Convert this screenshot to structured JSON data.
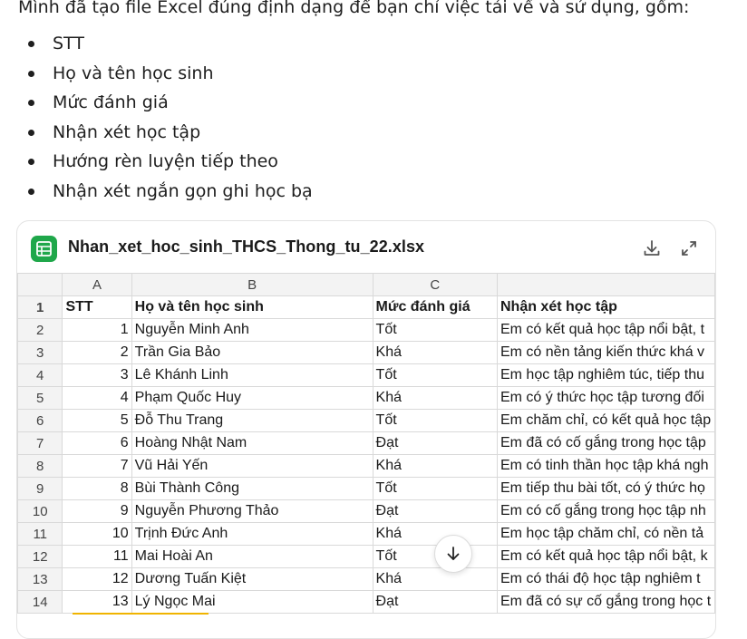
{
  "message": {
    "intro": "Mình đã tạo file Excel đúng định dạng để bạn chỉ việc tải về và sử dụng, gồm:",
    "bullets": [
      "STT",
      "Họ và tên học sinh",
      "Mức đánh giá",
      "Nhận xét học tập",
      "Hướng rèn luyện tiếp theo",
      "Nhận xét ngắn gọn ghi học bạ"
    ]
  },
  "file_card": {
    "file_name": "Nhan_xet_hoc_sinh_THCS_Thong_tu_22.xlsx",
    "icon": "spreadsheet-icon",
    "actions": [
      "download-icon",
      "expand-icon"
    ]
  },
  "sheet": {
    "column_letters": [
      "A",
      "B",
      "C",
      ""
    ],
    "header_row": {
      "num": "1",
      "cells": [
        "STT",
        "Họ và tên học sinh",
        "Mức đánh giá",
        "Nhận xét học tập"
      ]
    },
    "rows": [
      {
        "num": "2",
        "cells": [
          "1",
          "Nguyễn Minh Anh",
          "Tốt",
          "Em có kết quả học tập nổi bật, t"
        ]
      },
      {
        "num": "3",
        "cells": [
          "2",
          "Trần Gia Bảo",
          "Khá",
          "Em có nền tảng kiến thức khá v"
        ]
      },
      {
        "num": "4",
        "cells": [
          "3",
          "Lê Khánh Linh",
          "Tốt",
          "Em học tập nghiêm túc, tiếp thu"
        ]
      },
      {
        "num": "5",
        "cells": [
          "4",
          "Phạm Quốc Huy",
          "Khá",
          "Em có ý thức học tập tương đối"
        ]
      },
      {
        "num": "6",
        "cells": [
          "5",
          "Đỗ Thu Trang",
          "Tốt",
          "Em chăm chỉ, có kết quả học tập"
        ]
      },
      {
        "num": "7",
        "cells": [
          "6",
          "Hoàng Nhật Nam",
          "Đạt",
          "Em đã có cố gắng trong học tập"
        ]
      },
      {
        "num": "8",
        "cells": [
          "7",
          "Vũ Hải Yến",
          "Khá",
          "Em có tinh thần học tập khá ngh"
        ]
      },
      {
        "num": "9",
        "cells": [
          "8",
          "Bùi Thành Công",
          "Tốt",
          "Em tiếp thu bài tốt, có ý thức họ"
        ]
      },
      {
        "num": "10",
        "cells": [
          "9",
          "Nguyễn Phương Thảo",
          "Đạt",
          "Em có cố gắng trong học tập nh"
        ]
      },
      {
        "num": "11",
        "cells": [
          "10",
          "Trịnh Đức Anh",
          "Khá",
          "Em học tập chăm chỉ, có nền tả"
        ]
      },
      {
        "num": "12",
        "cells": [
          "11",
          "Mai Hoài An",
          "Tốt",
          "Em có kết quả học tập nổi bật, k"
        ]
      },
      {
        "num": "13",
        "cells": [
          "12",
          "Dương Tuấn Kiệt",
          "Khá",
          "Em có thái độ học tập nghiêm t"
        ]
      },
      {
        "num": "14",
        "cells": [
          "13",
          "Lý Ngọc Mai",
          "Đạt",
          "Em đã có sự cố gắng trong học t"
        ]
      }
    ]
  },
  "scroll_down_icon": "arrow-down-icon"
}
